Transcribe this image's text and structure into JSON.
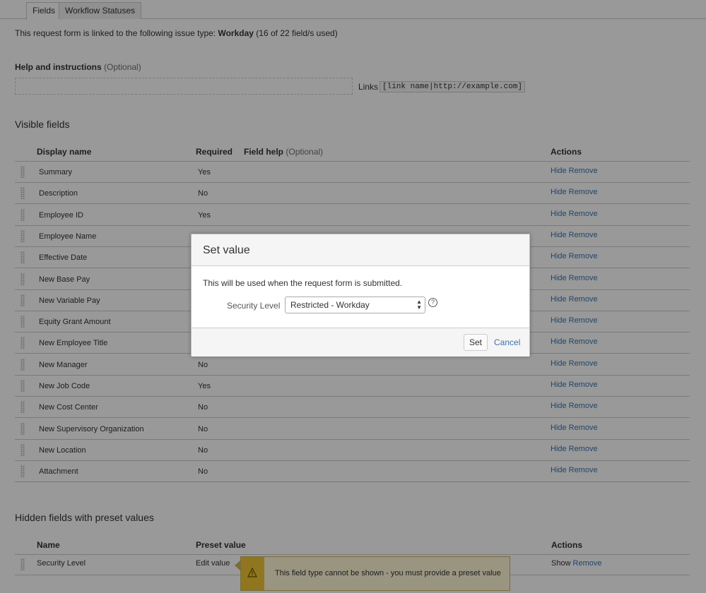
{
  "tabs": [
    {
      "label": "Fields"
    },
    {
      "label": "Workflow Statuses"
    }
  ],
  "linked": {
    "prefix": "This request form is linked to the following issue type:",
    "issue_type": "Workday",
    "usage": "(16 of 22 field/s used)"
  },
  "help": {
    "label": "Help and instructions",
    "optional": "(Optional)",
    "links_label": "Links",
    "links_example": "[link name|http://example.com]"
  },
  "visible": {
    "title": "Visible fields",
    "headers": {
      "display_name": "Display name",
      "required": "Required",
      "field_help": "Field help",
      "field_help_optional": "(Optional)",
      "actions": "Actions"
    },
    "rows": [
      {
        "name": "Summary",
        "required": "Yes"
      },
      {
        "name": "Description",
        "required": "No"
      },
      {
        "name": "Employee ID",
        "required": "Yes"
      },
      {
        "name": "Employee Name",
        "required": ""
      },
      {
        "name": "Effective Date",
        "required": ""
      },
      {
        "name": "New Base Pay",
        "required": ""
      },
      {
        "name": "New Variable Pay",
        "required": ""
      },
      {
        "name": "Equity Grant Amount",
        "required": ""
      },
      {
        "name": "New Employee Title",
        "required": ""
      },
      {
        "name": "New Manager",
        "required": "No"
      },
      {
        "name": "New Job Code",
        "required": "Yes"
      },
      {
        "name": "New Cost Center",
        "required": "No"
      },
      {
        "name": "New Supervisory Organization",
        "required": "No"
      },
      {
        "name": "New Location",
        "required": "No"
      },
      {
        "name": "Attachment",
        "required": "No"
      }
    ],
    "hide_label": "Hide",
    "remove_label": "Remove"
  },
  "hidden": {
    "title": "Hidden fields with preset values",
    "headers": {
      "name": "Name",
      "preset_value": "Preset value",
      "actions": "Actions"
    },
    "rows": [
      {
        "name": "Security Level",
        "preset": "Edit value",
        "show": "Show",
        "remove": "Remove"
      }
    ]
  },
  "tooltip": {
    "text": "This field type cannot be shown - you must provide a preset value",
    "icon": "warning-icon"
  },
  "dialog": {
    "title": "Set value",
    "description": "This will be used when the request form is submitted.",
    "field_label": "Security Level",
    "selected": "Restricted - Workday",
    "help_icon": "?",
    "set_label": "Set",
    "cancel_label": "Cancel"
  },
  "colors": {
    "link": "#3b73af",
    "tooltip_bg": "#fff8d6",
    "tooltip_stripe": "#f0c533"
  }
}
